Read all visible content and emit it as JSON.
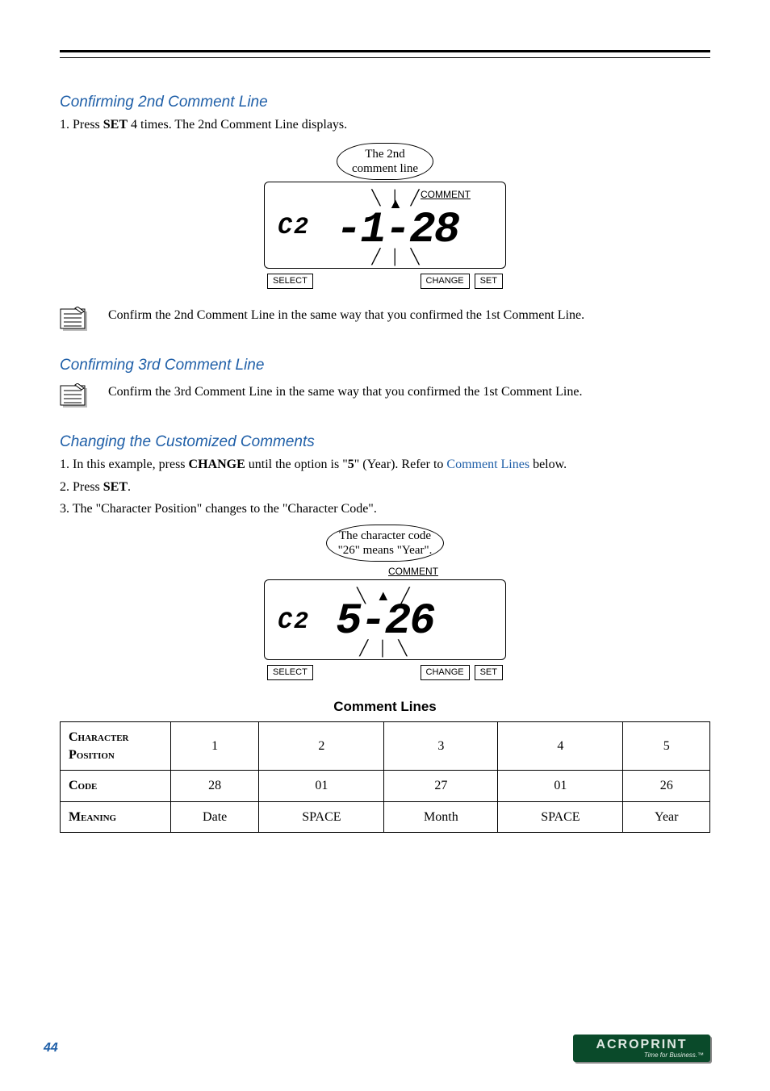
{
  "sections": {
    "s1": {
      "heading": "Confirming 2nd Comment Line",
      "line1_prefix": "1. Press ",
      "line1_bold": "SET",
      "line1_suffix": " 4 times. The 2nd Comment Line displays.",
      "diagram": {
        "callout_line1": "The 2nd",
        "callout_line2": "comment line",
        "comment_label": "COMMENT",
        "lcd_small": "C2",
        "lcd_big": "-1-28",
        "btn_select": "SELECT",
        "btn_change": "CHANGE",
        "btn_set": "SET"
      },
      "note": "Confirm the 2nd Comment Line in the same way that you confirmed the 1st Comment Line."
    },
    "s2": {
      "heading": "Confirming 3rd Comment Line",
      "note": "Confirm the 3rd Comment Line in the same way that you confirmed the 1st Comment Line."
    },
    "s3": {
      "heading": "Changing the Customized Comments",
      "l1_a": "1. In this example, press ",
      "l1_bold": "CHANGE",
      "l1_b": " until the option is \"",
      "l1_bold2": "5",
      "l1_c": "\" (Year). Refer to ",
      "l1_link": "Comment Lines",
      "l1_d": " below.",
      "l2_a": "2. Press ",
      "l2_bold": "SET",
      "l2_b": ".",
      "l3": "3. The \"Character Position\" changes to the \"Character Code\".",
      "diagram": {
        "callout_line1": "The character code",
        "callout_line2": "\"26\" means \"Year\".",
        "comment_label": "COMMENT",
        "lcd_small": "C2",
        "lcd_big": "5-26",
        "btn_select": "SELECT",
        "btn_change": "CHANGE",
        "btn_set": "SET"
      }
    },
    "table": {
      "title": "Comment Lines",
      "row_headers": {
        "r1": "Character Position",
        "r2": "Code",
        "r3": "Meaning"
      },
      "cols": [
        "1",
        "2",
        "3",
        "4",
        "5"
      ],
      "code": [
        "28",
        "01",
        "27",
        "01",
        "26"
      ],
      "meaning": [
        "Date",
        "SPACE",
        "Month",
        "SPACE",
        "Year"
      ]
    }
  },
  "footer": {
    "page": "44",
    "brand": "ACROPRINT",
    "tag": "Time for Business.™"
  }
}
